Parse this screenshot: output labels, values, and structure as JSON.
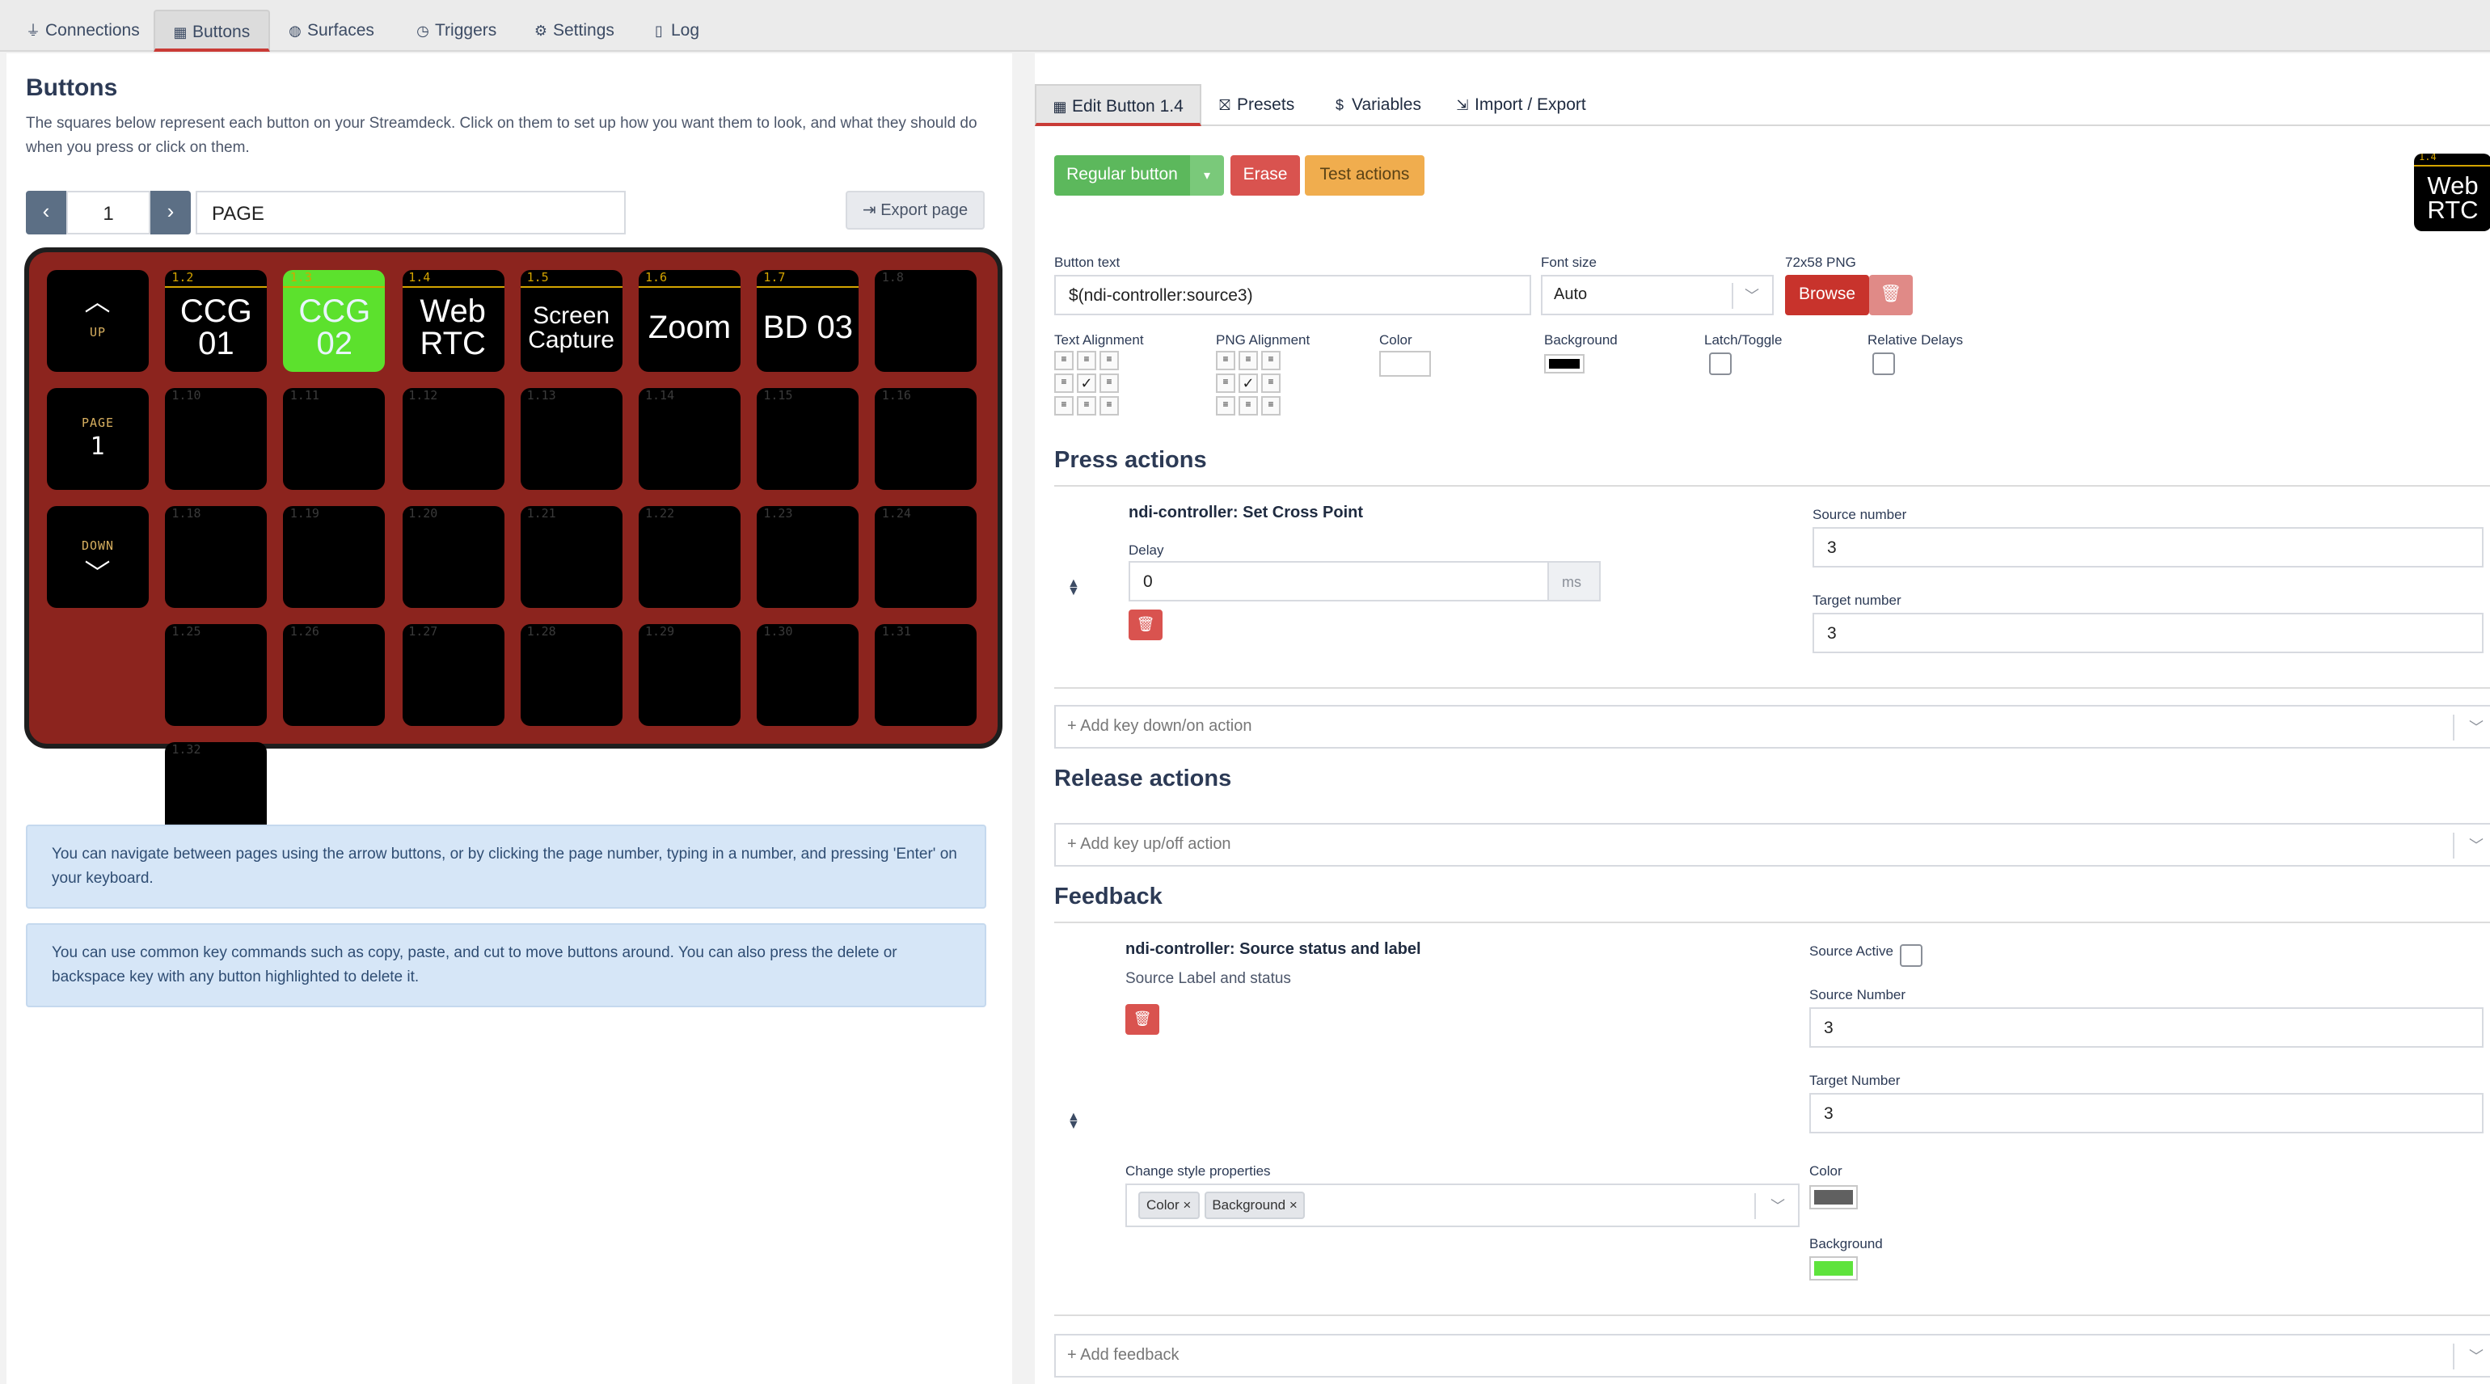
{
  "topnav": {
    "tabs": [
      {
        "label": "Connections",
        "icon": "plug-icon",
        "glyph": "⏚"
      },
      {
        "label": "Buttons",
        "icon": "calculator-icon",
        "glyph": "▦"
      },
      {
        "label": "Surfaces",
        "icon": "gamepad-icon",
        "glyph": "◍"
      },
      {
        "label": "Triggers",
        "icon": "clock-icon",
        "glyph": "◷"
      },
      {
        "label": "Settings",
        "icon": "user-cog-icon",
        "glyph": "⚙"
      },
      {
        "label": "Log",
        "icon": "file-icon",
        "glyph": "▯"
      }
    ],
    "active": "Buttons"
  },
  "buttons_panel": {
    "title": "Buttons",
    "description": "The squares below represent each button on your Streamdeck. Click on them to set up how you want them to look, and what they should do when you press or click on them.",
    "prev": "‹",
    "next": "›",
    "page_number": "1",
    "page_name": "PAGE",
    "export_label": "Export page",
    "export_glyph": "⇥",
    "system_keys": {
      "up": "UP",
      "page": "PAGE",
      "page_value": "1",
      "down": "DOWN",
      "up_glyph": "︿",
      "down_glyph": "﹀"
    },
    "keys": [
      {
        "id": "1.2",
        "lines": [
          "CCG",
          "01"
        ],
        "bg": "#000000",
        "fg": "#ffffff",
        "size": 20
      },
      {
        "id": "1.3",
        "lines": [
          "CCG",
          "02"
        ],
        "bg": "#5ce12d",
        "fg": "#e9f5ff",
        "size": 20
      },
      {
        "id": "1.4",
        "lines": [
          "Web",
          "RTC"
        ],
        "bg": "#000000",
        "fg": "#ffffff",
        "size": 20
      },
      {
        "id": "1.5",
        "lines": [
          "Screen",
          "Capture"
        ],
        "bg": "#000000",
        "fg": "#ffffff",
        "size": 15
      },
      {
        "id": "1.6",
        "lines": [
          "Zoom"
        ],
        "bg": "#000000",
        "fg": "#ffffff",
        "size": 20
      },
      {
        "id": "1.7",
        "lines": [
          "BD 03"
        ],
        "bg": "#000000",
        "fg": "#ffffff",
        "size": 20
      },
      {
        "id": "1.8"
      },
      {
        "id": "1.10"
      },
      {
        "id": "1.11"
      },
      {
        "id": "1.12"
      },
      {
        "id": "1.13"
      },
      {
        "id": "1.14"
      },
      {
        "id": "1.15"
      },
      {
        "id": "1.16"
      },
      {
        "id": "1.18"
      },
      {
        "id": "1.19"
      },
      {
        "id": "1.20"
      },
      {
        "id": "1.21"
      },
      {
        "id": "1.22"
      },
      {
        "id": "1.23"
      },
      {
        "id": "1.24"
      },
      {
        "id": "1.25"
      },
      {
        "id": "1.26"
      },
      {
        "id": "1.27"
      },
      {
        "id": "1.28"
      },
      {
        "id": "1.29"
      },
      {
        "id": "1.30"
      },
      {
        "id": "1.31"
      },
      {
        "id": "1.32"
      }
    ],
    "notes": [
      "You can navigate between pages using the arrow buttons, or by clicking the page number, typing in a number, and pressing 'Enter' on your keyboard.",
      "You can use common key commands such as copy, paste, and cut to move buttons around. You can also press the delete or backspace key with any button highlighted to delete it."
    ]
  },
  "editor": {
    "tabs": [
      {
        "label": "Edit Button 1.4",
        "icon": "calculator-icon",
        "glyph": "▦"
      },
      {
        "label": "Presets",
        "icon": "gift-icon",
        "glyph": "⛝"
      },
      {
        "label": "Variables",
        "icon": "dollar-icon",
        "glyph": "$"
      },
      {
        "label": "Import / Export",
        "icon": "file-import-icon",
        "glyph": "⇲"
      }
    ],
    "button_type": "Regular button",
    "caret": "▾",
    "erase": "Erase",
    "test_actions": "Test actions",
    "preview": {
      "id": "1.4",
      "lines": [
        "Web",
        "RTC"
      ]
    },
    "fields": {
      "button_text_label": "Button text",
      "button_text_value": "$(ndi-controller:source3)",
      "font_size_label": "Font size",
      "font_size_value": "Auto",
      "png_label": "72x58 PNG",
      "browse": "Browse",
      "text_alignment_label": "Text Alignment",
      "png_alignment_label": "PNG Alignment",
      "color_label": "Color",
      "background_label": "Background",
      "latch_label": "Latch/Toggle",
      "relative_delays_label": "Relative Delays"
    },
    "colors": {
      "text_color": "#ffffff",
      "background": "#000000",
      "feedback_color": "#606060",
      "feedback_background": "#5ee33c",
      "success": "#5cb85c",
      "danger": "#d9534f",
      "warning": "#f0ad4e"
    },
    "press_actions": {
      "title": "Press actions",
      "action_name": "ndi-controller: Set Cross Point",
      "delay_label": "Delay",
      "delay_value": "0",
      "delay_unit": "ms",
      "source_label": "Source number",
      "source_value": "3",
      "target_label": "Target number",
      "target_value": "3",
      "add_placeholder": "+ Add key down/on action"
    },
    "release_actions": {
      "title": "Release actions",
      "add_placeholder": "+ Add key up/off action"
    },
    "feedback": {
      "title": "Feedback",
      "name": "ndi-controller: Source status and label",
      "description": "Source Label and status",
      "source_active_label": "Source Active",
      "source_number_label": "Source Number",
      "source_number_value": "3",
      "target_number_label": "Target Number",
      "target_number_value": "3",
      "style_label": "Change style properties",
      "style_tags": [
        "Color",
        "Background"
      ],
      "color_label": "Color",
      "background_label": "Background",
      "add_placeholder": "+ Add feedback"
    }
  }
}
